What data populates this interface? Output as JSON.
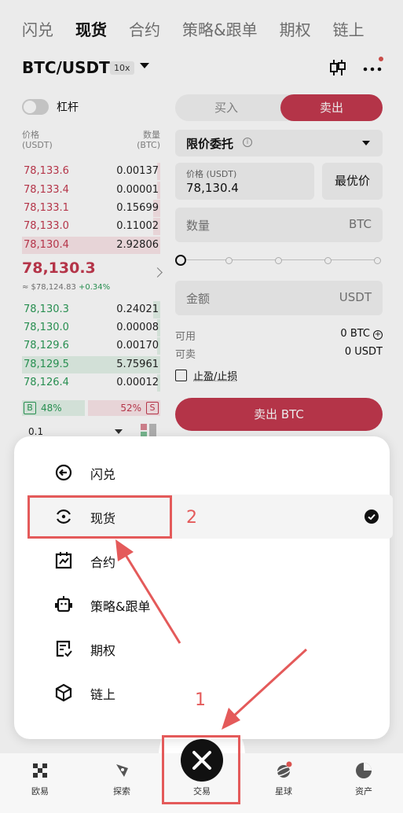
{
  "top_tabs": [
    "闪兑",
    "现货",
    "合约",
    "策略&跟单",
    "期权",
    "链上"
  ],
  "pair": {
    "name": "BTC/USDT",
    "leverage": "10x"
  },
  "margin_toggle_label": "杠杆",
  "order_book": {
    "price_header_line1": "价格",
    "price_header_line2": "(USDT)",
    "qty_header_line1": "数量",
    "qty_header_line2": "(BTC)",
    "asks": [
      {
        "price": "78,133.6",
        "qty": "0.00137",
        "depth": 0.02
      },
      {
        "price": "78,133.4",
        "qty": "0.00001",
        "depth": 0.02
      },
      {
        "price": "78,133.1",
        "qty": "0.15699",
        "depth": 0.05
      },
      {
        "price": "78,133.0",
        "qty": "0.11002",
        "depth": 0.05
      },
      {
        "price": "78,130.4",
        "qty": "2.92806",
        "depth": 1.0
      }
    ],
    "last_price": "78,130.3",
    "last_price_usd": "≈ $78,124.83",
    "change": "+0.34%",
    "bids": [
      {
        "price": "78,130.3",
        "qty": "0.24021",
        "depth": 0.05
      },
      {
        "price": "78,130.0",
        "qty": "0.00008",
        "depth": 0.02
      },
      {
        "price": "78,129.6",
        "qty": "0.00170",
        "depth": 0.02
      },
      {
        "price": "78,129.5",
        "qty": "5.75961",
        "depth": 1.0
      },
      {
        "price": "78,126.4",
        "qty": "0.00012",
        "depth": 0.02
      }
    ],
    "buy_ratio_badge": "B",
    "buy_ratio": "48%",
    "sell_ratio": "52%",
    "sell_ratio_badge": "S",
    "depth_step": "0.1"
  },
  "trade_form": {
    "buy_tab": "买入",
    "sell_tab": "卖出",
    "order_type": "限价委托",
    "price_label": "价格 (USDT)",
    "price_value": "78,130.4",
    "best_price_button": "最优价",
    "qty_label": "数量",
    "qty_unit": "BTC",
    "slider_percent": 0,
    "amount_label": "金额",
    "amount_unit": "USDT",
    "available_label": "可用",
    "available_value": "0 BTC",
    "sellable_label": "可卖",
    "sellable_value": "0 USDT",
    "tpsl_label": "止盈/止损",
    "submit_label": "卖出 BTC"
  },
  "menu": {
    "items": [
      {
        "label": "闪兑",
        "icon": "flash-swap-icon"
      },
      {
        "label": "现货",
        "icon": "spot-icon",
        "selected": true
      },
      {
        "label": "合约",
        "icon": "contract-icon"
      },
      {
        "label": "策略&跟单",
        "icon": "strategy-bot-icon"
      },
      {
        "label": "期权",
        "icon": "options-icon"
      },
      {
        "label": "链上",
        "icon": "onchain-icon"
      }
    ]
  },
  "annotations": {
    "label_1": "1",
    "label_2": "2",
    "color": "#e45a5a"
  },
  "bottom_nav": [
    {
      "label": "欧易",
      "icon": "okx-logo-icon"
    },
    {
      "label": "探索",
      "icon": "explore-icon"
    },
    {
      "label": "交易",
      "icon": "close-icon"
    },
    {
      "label": "星球",
      "icon": "planet-icon"
    },
    {
      "label": "资产",
      "icon": "assets-pie-icon"
    }
  ],
  "colors": {
    "sell_red": "#c4394f",
    "buy_green": "#2b9b57",
    "annotation": "#e45a5a"
  }
}
